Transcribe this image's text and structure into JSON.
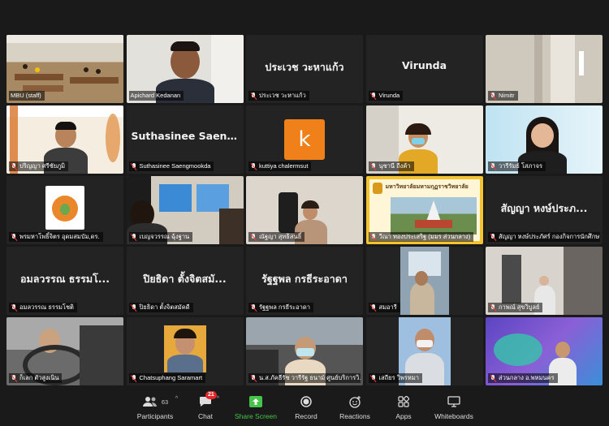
{
  "tiles": [
    {
      "label": "MBU (staff)",
      "big": "",
      "muted": false
    },
    {
      "label": "Apichard Kedanan",
      "big": "",
      "muted": false
    },
    {
      "label": "ประเวช วะหาแก้ว",
      "big": "ประเวช วะหาแก้ว",
      "muted": true
    },
    {
      "label": "Virunda",
      "big": "Virunda",
      "muted": true
    },
    {
      "label": "Nimitr",
      "big": "",
      "muted": true
    },
    {
      "label": "ปริญญา ศรีชัยภูมิ",
      "big": "",
      "muted": true
    },
    {
      "label": "Suthasinee Saengmookda",
      "big": "Suthasinee Saen...",
      "muted": true
    },
    {
      "label": "kuttiya chalermsut",
      "big": "",
      "avatar": "k",
      "muted": true
    },
    {
      "label": "นุชานี ถีงค้า",
      "big": "",
      "muted": true
    },
    {
      "label": "วารีรัมย์ โสภาจร",
      "big": "",
      "muted": true
    },
    {
      "label": "พรมหาโพธิ์จิตร อุดมสมบัม,ดร.",
      "big": "",
      "muted": true
    },
    {
      "label": "เบญจวรรณ ฉุ้งฐาน",
      "big": "",
      "muted": true
    },
    {
      "label": "ณัฐญา สุทธิสนธิ์",
      "big": "",
      "muted": true
    },
    {
      "label": "วีณา ทองประเสริฐ (มมร ส่วนกลาง)",
      "big": "",
      "muted": true
    },
    {
      "label": "สัญญา หงษ์ประภัศร์ กองกิจการนักศึกษา",
      "big": "สัญญา หงษ์ประภ...",
      "muted": true
    },
    {
      "label": "อมลวรรณ ธรรมโชติ",
      "big": "อมลวรรณ ธรรมโ...",
      "muted": true
    },
    {
      "label": "ปิยธิดา ตั้งจิตสมัคดี",
      "big": "ปิยธิดา ตั้งจิตสมั...",
      "muted": true
    },
    {
      "label": "รัฐฐพล กรธีระอาดา",
      "big": "รัฐฐพล กรธีระอาดา",
      "muted": true
    },
    {
      "label": "สมอารี",
      "big": "",
      "muted": true
    },
    {
      "label": "กาพณ์ สุขวิบูลย์",
      "big": "",
      "muted": true
    },
    {
      "label": "ก็เลก ตัวสูงเนิน",
      "big": "",
      "muted": true
    },
    {
      "label": "Chatsuphang Saramart",
      "big": "",
      "muted": true
    },
    {
      "label": "น.ส.ภัคธีรัช วารีรัฐ ธนาม์ ศูนย์บริการวิ...",
      "big": "",
      "muted": true
    },
    {
      "label": "เสถียร วิพรหมา",
      "big": "",
      "muted": true
    },
    {
      "label": "ส่วนกลาง อ.พหมนคร",
      "big": "",
      "muted": true
    }
  ],
  "tile4_sign": "มหาวิทยาลัยมหามกุฏราชวิทยาลัย",
  "toolbar": {
    "participants_label": "Participants",
    "participants_count": "63",
    "chat_label": "Chat",
    "chat_badge": "21",
    "share_label": "Share Screen",
    "record_label": "Record",
    "reactions_label": "Reactions",
    "apps_label": "Apps",
    "whiteboards_label": "Whiteboards"
  },
  "colors": {
    "active_border": "#b5e853",
    "share_green": "#47c44a",
    "badge_red": "#e02828",
    "avatar_orange": "#f08019"
  }
}
